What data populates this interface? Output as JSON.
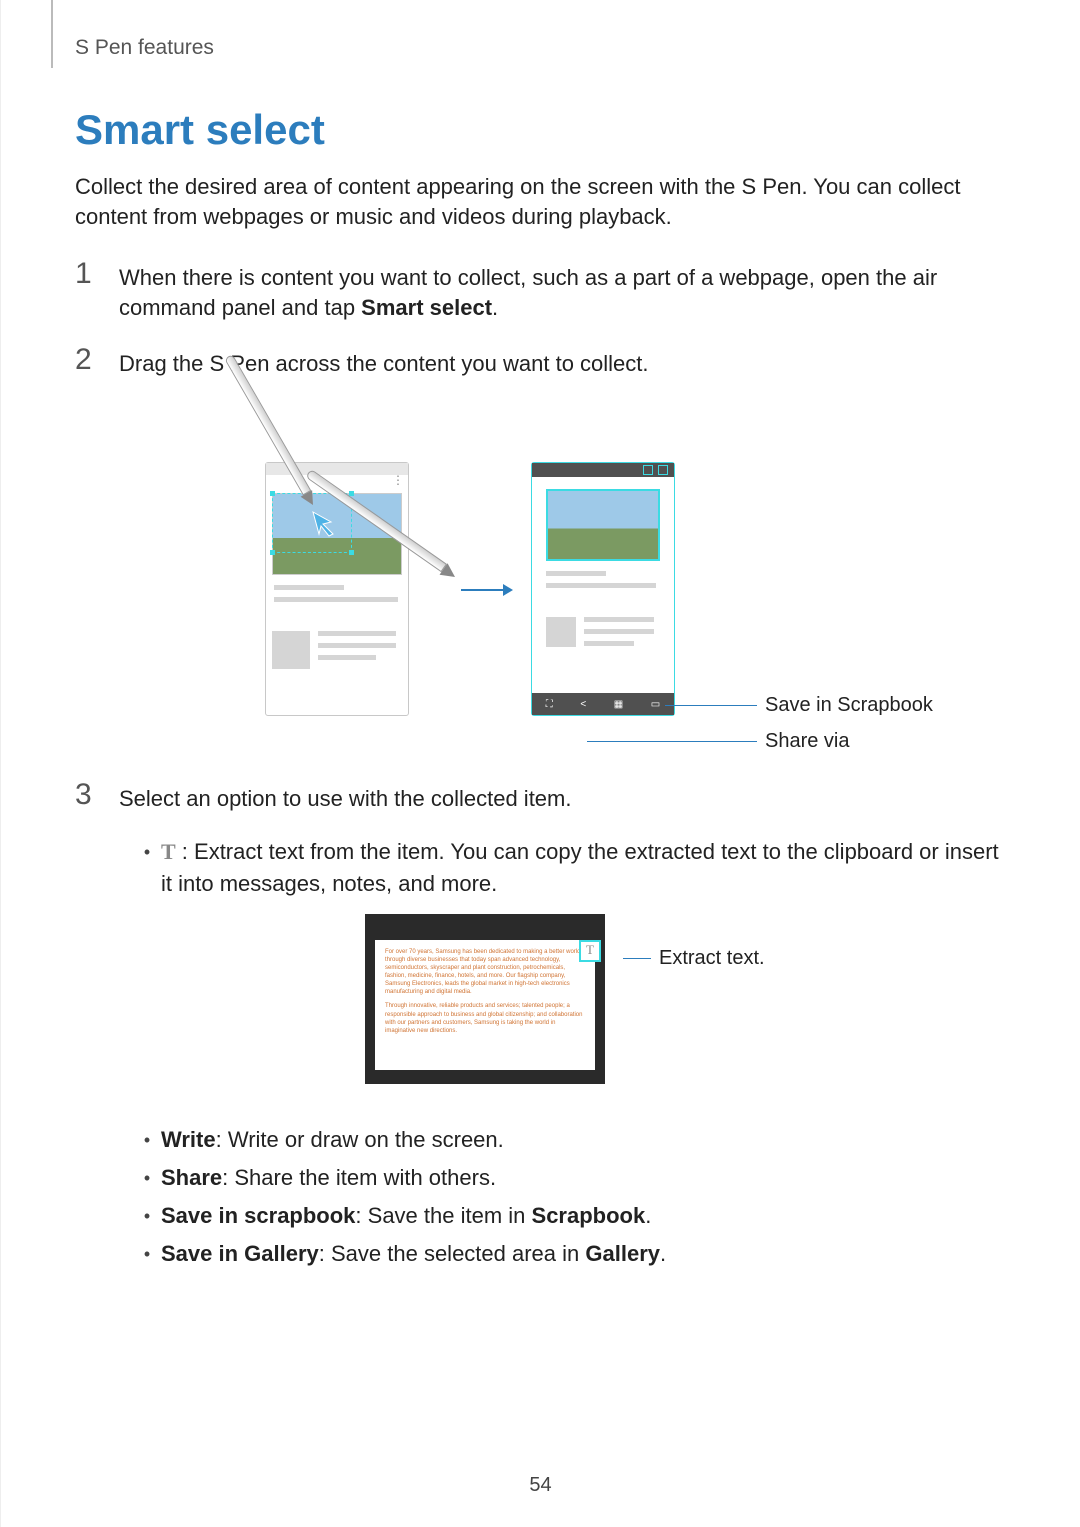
{
  "header": "S Pen features",
  "title": "Smart select",
  "intro": "Collect the desired area of content appearing on the screen with the S Pen. You can collect content from webpages or music and videos during playback.",
  "steps": {
    "s1_num": "1",
    "s1_a": "When there is content you want to collect, such as a part of a webpage, open the air command panel and tap ",
    "s1_b": "Smart select",
    "s1_c": ".",
    "s2_num": "2",
    "s2": "Drag the S Pen across the content you want to collect.",
    "s3_num": "3",
    "s3": "Select an option to use with the collected item."
  },
  "fig1": {
    "callout_scrapbook": "Save in Scrapbook",
    "callout_share": "Share via"
  },
  "bullets": {
    "t_icon": "T",
    "t_text": " : Extract text from the item. You can copy the extracted text to the clipboard or insert it into messages, notes, and more.",
    "write_b": "Write",
    "write_t": ": Write or draw on the screen.",
    "share_b": "Share",
    "share_t": ": Share the item with others.",
    "scrap_b": "Save in scrapbook",
    "scrap_t_a": ": Save the item in ",
    "scrap_t_b": "Scrapbook",
    "scrap_t_c": ".",
    "gal_b": "Save in Gallery",
    "gal_t_a": ": Save the selected area in ",
    "gal_t_b": "Gallery",
    "gal_t_c": "."
  },
  "fig2": {
    "p1": "For over 70 years, Samsung has been dedicated to making a better world through diverse businesses that today span advanced technology, semiconductors, skyscraper and plant construction, petrochemicals, fashion, medicine, finance, hotels, and more. Our flagship company, Samsung Electronics, leads the global market in high-tech electronics manufacturing and digital media.",
    "p2": "Through innovative, reliable products and services; talented people; a responsible approach to business and global citizenship; and collaboration with our partners and customers, Samsung is taking the world in imaginative new directions.",
    "t_box": "T",
    "callout": "Extract text."
  },
  "page_number": "54"
}
